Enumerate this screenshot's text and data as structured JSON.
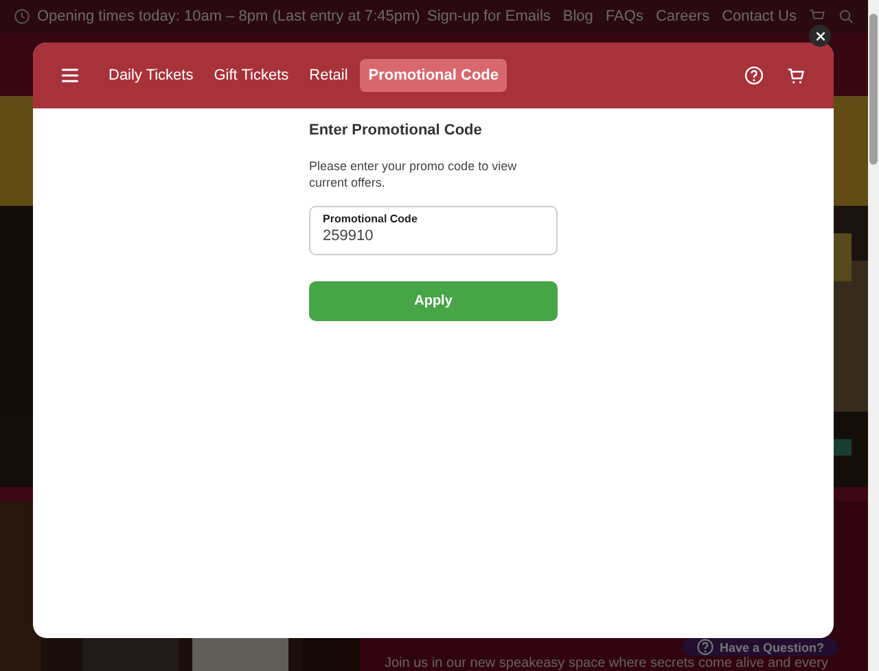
{
  "top_bar": {
    "opening_times": "Opening times today: 10am – 8pm (Last entry at 7:45pm)",
    "links": [
      "Sign-up for Emails",
      "Blog",
      "FAQs",
      "Careers",
      "Contact Us"
    ]
  },
  "modal": {
    "tabs": [
      {
        "label": "Daily Tickets",
        "selected": false
      },
      {
        "label": "Gift Tickets",
        "selected": false
      },
      {
        "label": "Retail",
        "selected": false
      },
      {
        "label": "Promotional Code",
        "selected": true
      }
    ],
    "heading": "Enter Promotional Code",
    "description": "Please enter your promo code to view current offers.",
    "field": {
      "label": "Promotional Code",
      "value": "259910"
    },
    "button": "Apply"
  },
  "help_button": "Have a Question?",
  "intro_text": "Join us in our new speakeasy space where secrets come alive and every"
}
